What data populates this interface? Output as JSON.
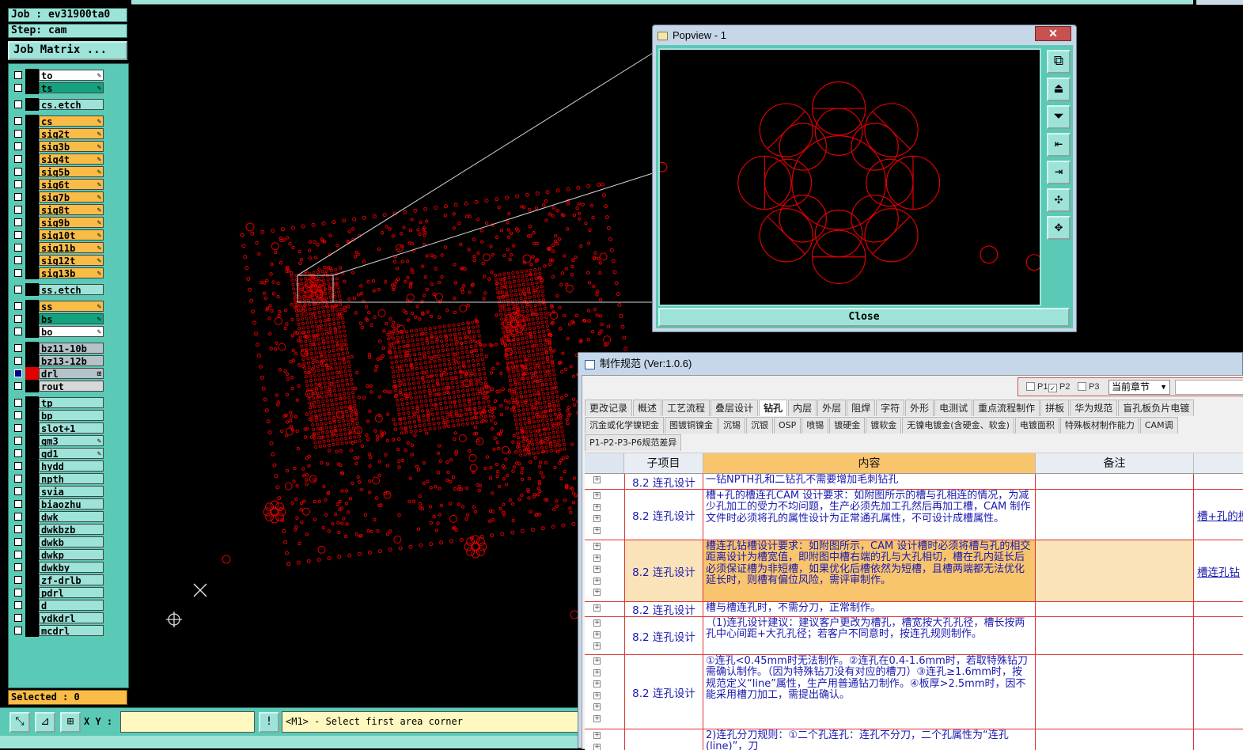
{
  "job": {
    "job_line": "Job : ev31900ta0",
    "step_line": "Step: cam",
    "matrix_button": "Job Matrix ..."
  },
  "layers": [
    {
      "name": "to",
      "style": "white",
      "editable": true,
      "checked": false
    },
    {
      "name": "ts",
      "style": "green",
      "editable": true,
      "checked": false
    },
    {
      "name": "cs.etch",
      "style": "teal",
      "editable": false,
      "checked": false,
      "gap": true
    },
    {
      "name": "cs",
      "style": "orange",
      "editable": true,
      "checked": false,
      "gap": true
    },
    {
      "name": "sig2t",
      "style": "orange",
      "editable": true,
      "checked": false
    },
    {
      "name": "sig3b",
      "style": "orange",
      "editable": true,
      "checked": false
    },
    {
      "name": "sig4t",
      "style": "orange",
      "editable": true,
      "checked": false
    },
    {
      "name": "sig5b",
      "style": "orange",
      "editable": true,
      "checked": false
    },
    {
      "name": "sig6t",
      "style": "orange",
      "editable": true,
      "checked": false
    },
    {
      "name": "sig7b",
      "style": "orange",
      "editable": true,
      "checked": false
    },
    {
      "name": "sig8t",
      "style": "orange",
      "editable": true,
      "checked": false
    },
    {
      "name": "sig9b",
      "style": "orange",
      "editable": true,
      "checked": false
    },
    {
      "name": "sig10t",
      "style": "orange",
      "editable": true,
      "checked": false
    },
    {
      "name": "sig11b",
      "style": "orange",
      "editable": true,
      "checked": false
    },
    {
      "name": "sig12t",
      "style": "orange",
      "editable": true,
      "checked": false
    },
    {
      "name": "sig13b",
      "style": "orange",
      "editable": true,
      "checked": false
    },
    {
      "name": "ss.etch",
      "style": "teal",
      "editable": false,
      "checked": false,
      "gap": true
    },
    {
      "name": "ss",
      "style": "orange",
      "editable": true,
      "checked": false,
      "gap": true
    },
    {
      "name": "bs",
      "style": "green",
      "editable": true,
      "checked": false
    },
    {
      "name": "bo",
      "style": "white",
      "editable": true,
      "checked": false
    },
    {
      "name": "bz11-10b",
      "style": "gray",
      "editable": false,
      "checked": false,
      "gap": true
    },
    {
      "name": "bz13-12b",
      "style": "gray",
      "editable": false,
      "checked": false
    },
    {
      "name": "drl",
      "style": "gray",
      "editable": false,
      "checked": true,
      "color": "red"
    },
    {
      "name": "rout",
      "style": "lgray",
      "editable": false,
      "checked": false
    },
    {
      "name": "tp",
      "style": "teal",
      "editable": false,
      "checked": false,
      "gap": true
    },
    {
      "name": "bp",
      "style": "teal",
      "editable": false,
      "checked": false
    },
    {
      "name": "slot+1",
      "style": "teal",
      "editable": false,
      "checked": false
    },
    {
      "name": "gm3",
      "style": "teal",
      "editable": true,
      "checked": false
    },
    {
      "name": "gd1",
      "style": "teal",
      "editable": true,
      "checked": false
    },
    {
      "name": "hydd",
      "style": "teal",
      "editable": false,
      "checked": false
    },
    {
      "name": "npth",
      "style": "teal",
      "editable": false,
      "checked": false
    },
    {
      "name": "svia",
      "style": "teal",
      "editable": false,
      "checked": false
    },
    {
      "name": "biaozhu",
      "style": "teal",
      "editable": false,
      "checked": false
    },
    {
      "name": "dwk",
      "style": "teal",
      "editable": false,
      "checked": false
    },
    {
      "name": "dwkbzb",
      "style": "teal",
      "editable": false,
      "checked": false
    },
    {
      "name": "dwkb",
      "style": "teal",
      "editable": false,
      "checked": false
    },
    {
      "name": "dwkp",
      "style": "teal",
      "editable": false,
      "checked": false
    },
    {
      "name": "dwkby",
      "style": "teal",
      "editable": false,
      "checked": false
    },
    {
      "name": "zf-drlb",
      "style": "teal",
      "editable": false,
      "checked": false
    },
    {
      "name": "pdrl",
      "style": "teal",
      "editable": false,
      "checked": false
    },
    {
      "name": "d",
      "style": "teal",
      "editable": false,
      "checked": false
    },
    {
      "name": "ydkdrl",
      "style": "teal",
      "editable": false,
      "checked": false
    },
    {
      "name": "mcdrl",
      "style": "teal",
      "editable": false,
      "checked": false
    }
  ],
  "status": {
    "selected": "Selected : 0",
    "xy_label": "X Y :",
    "xy_value": "",
    "alert_glyph": "!",
    "prompt": "<M1> - Select first area corner"
  },
  "popview": {
    "title": "Popview - 1",
    "close_x": "✕",
    "close_button": "Close"
  },
  "spec": {
    "title": "制作规范 (Ver:1.0.6)",
    "options": {
      "p1": "P1",
      "p2": "P2",
      "p3": "P3",
      "p1_checked": false,
      "p2_checked": true,
      "p3_checked": false,
      "section": "当前章节"
    },
    "tabs_row1": [
      "更改记录",
      "概述",
      "工艺流程",
      "叠层设计",
      "钻孔",
      "内层",
      "外层",
      "阻焊",
      "字符",
      "外形",
      "电测试",
      "重点流程制作",
      "拼板",
      "华为规范",
      "盲孔板负片电镀"
    ],
    "active_tab": "钻孔",
    "tabs_row2": [
      "沉金或化学镍钯金",
      "图镀铜镍金",
      "沉锡",
      "沉银",
      "OSP",
      "喷锡",
      "镀硬金",
      "镀软金",
      "无镍电镀金(含硬金、软金)",
      "电镀面积",
      "特殊板材制作能力",
      "CAM调"
    ],
    "tabs_row3": [
      "P1-P2-P3-P6规范差异"
    ],
    "columns": {
      "sub": "子项目",
      "content": "内容",
      "note": "备注"
    },
    "rows": [
      {
        "sub": "8.2 连孔设计",
        "content": "一钻NPTH孔和二钻孔不需要增加毛刺钻孔",
        "link": "",
        "h": 20
      },
      {
        "sub": "8.2 连孔设计",
        "content": "槽+孔的槽连孔CAM 设计要求：如附图所示的槽与孔相连的情况，为减少孔加工的受力不均问题，生产必须先加工孔然后再加工槽，CAM 制作文件时必须将孔的属性设计为正常通孔属性，不可设计成槽属性。",
        "link": "槽+孔的槽",
        "h": 64
      },
      {
        "sub": "8.2 连孔设计",
        "content": "槽连孔钻槽设计要求：如附图所示，CAM 设计槽时必须将槽与孔的相交距离设计为槽宽值，即附图中槽右端的孔与大孔相切，槽在孔内延长后必须保证槽为非短槽，如果优化后槽依然为短槽，且槽两端都无法优化延长时，则槽有偏位风险，需评审制作。",
        "link": "槽连孔钻",
        "h": 78,
        "highlight": true
      },
      {
        "sub": "8.2 连孔设计",
        "content": "槽与槽连孔时，不需分刀，正常制作。",
        "link": "",
        "h": 19
      },
      {
        "sub": "8.2 连孔设计",
        "content": "（1)连孔设计建议：建议客户更改为槽孔，槽宽按大孔孔径，槽长按两孔中心间距+大孔孔径；若客户不同意时，按连孔规则制作。",
        "link": "",
        "h": 48
      },
      {
        "sub": "8.2 连孔设计",
        "content": "①连孔<0.45mm时无法制作。②连孔在0.4-1.6mm时，若取特殊钻刀需确认制作。（因为特殊钻刀没有对应的槽刀）③连孔≥1.6mm时，按规范定义“line”属性，生产用普通钻刀制作。④板厚>2.5mm时，因不能采用槽刀加工，需提出确认。",
        "link": "",
        "h": 94
      },
      {
        "sub": "",
        "content": "2)连孔分刀规则：①二个孔连孔：连孔不分刀，二个孔属性为“连孔(line)”，刀",
        "link": "",
        "h": 34
      }
    ]
  }
}
